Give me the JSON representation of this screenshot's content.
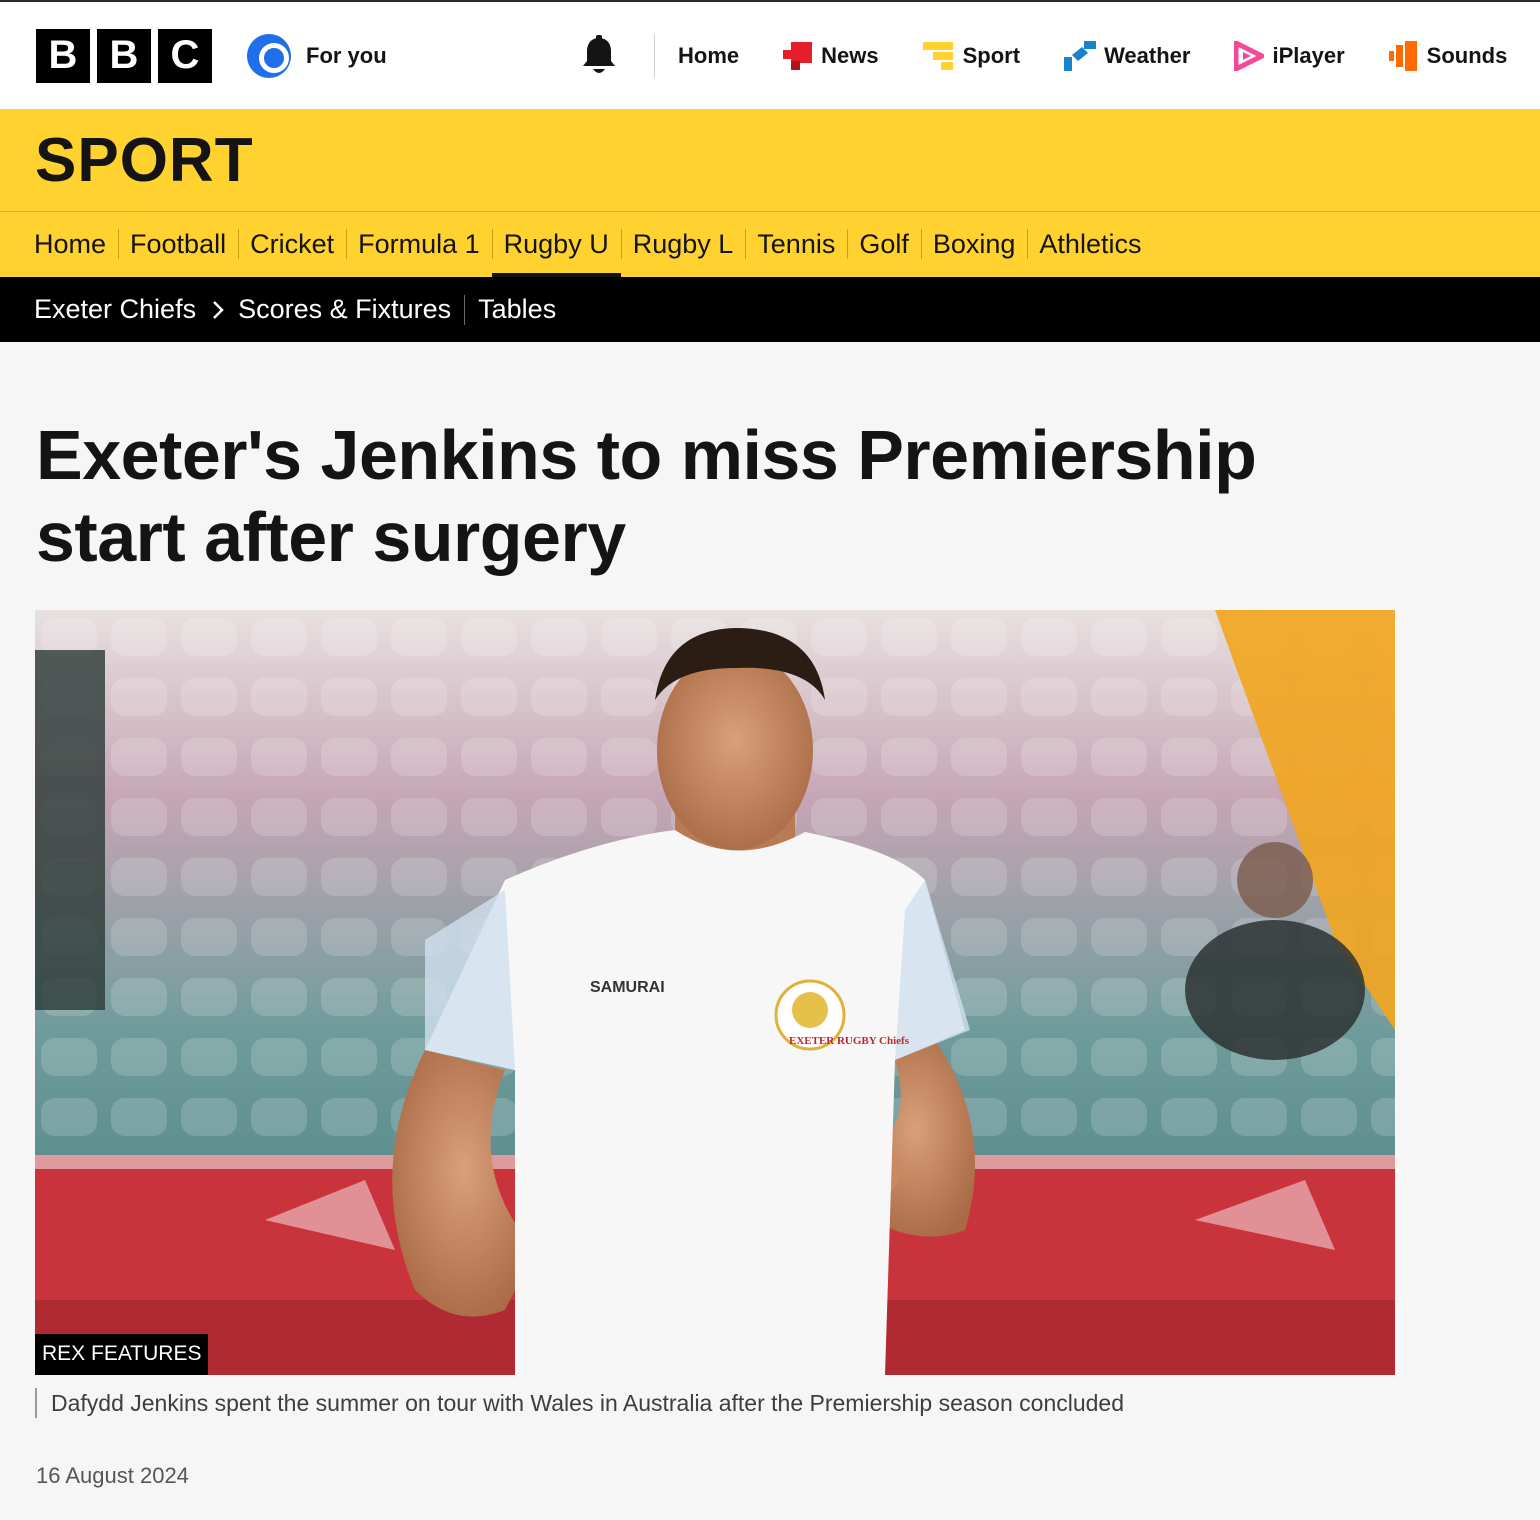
{
  "global_header": {
    "logo_letters": [
      "B",
      "B",
      "C"
    ],
    "for_you_label": "For you",
    "nav": [
      {
        "label": "Home",
        "icon": "home"
      },
      {
        "label": "News",
        "icon": "news-icon"
      },
      {
        "label": "Sport",
        "icon": "sport-icon"
      },
      {
        "label": "Weather",
        "icon": "weather-icon"
      },
      {
        "label": "iPlayer",
        "icon": "iplayer-icon"
      },
      {
        "label": "Sounds",
        "icon": "sounds-icon"
      }
    ]
  },
  "masthead": {
    "title": "SPORT"
  },
  "sport_nav": [
    {
      "label": "Home"
    },
    {
      "label": "Football"
    },
    {
      "label": "Cricket"
    },
    {
      "label": "Formula 1"
    },
    {
      "label": "Rugby U",
      "active": true
    },
    {
      "label": "Rugby L"
    },
    {
      "label": "Tennis"
    },
    {
      "label": "Golf"
    },
    {
      "label": "Boxing"
    },
    {
      "label": "Athletics"
    }
  ],
  "sub_nav": {
    "team": "Exeter Chiefs",
    "links": [
      "Scores & Fixtures",
      "Tables"
    ]
  },
  "article": {
    "headline": "Exeter's Jenkins to miss Premiership start after surgery",
    "image_credit": "REX FEATURES",
    "jersey_sponsor": "SAMURAI",
    "crest_text": "EXETER RUGBY Chiefs",
    "caption": "Dafydd Jenkins spent the summer on tour with Wales in Australia after the Premiership season concluded",
    "date": "16 August 2024"
  },
  "colors": {
    "sport_yellow": "#ffd230",
    "news_red": "#e51e2b",
    "weather_blue": "#1a82c8",
    "iplayer_pink": "#f54997",
    "sounds_orange": "#ff6b00",
    "foryou_blue": "#1f6feb"
  }
}
